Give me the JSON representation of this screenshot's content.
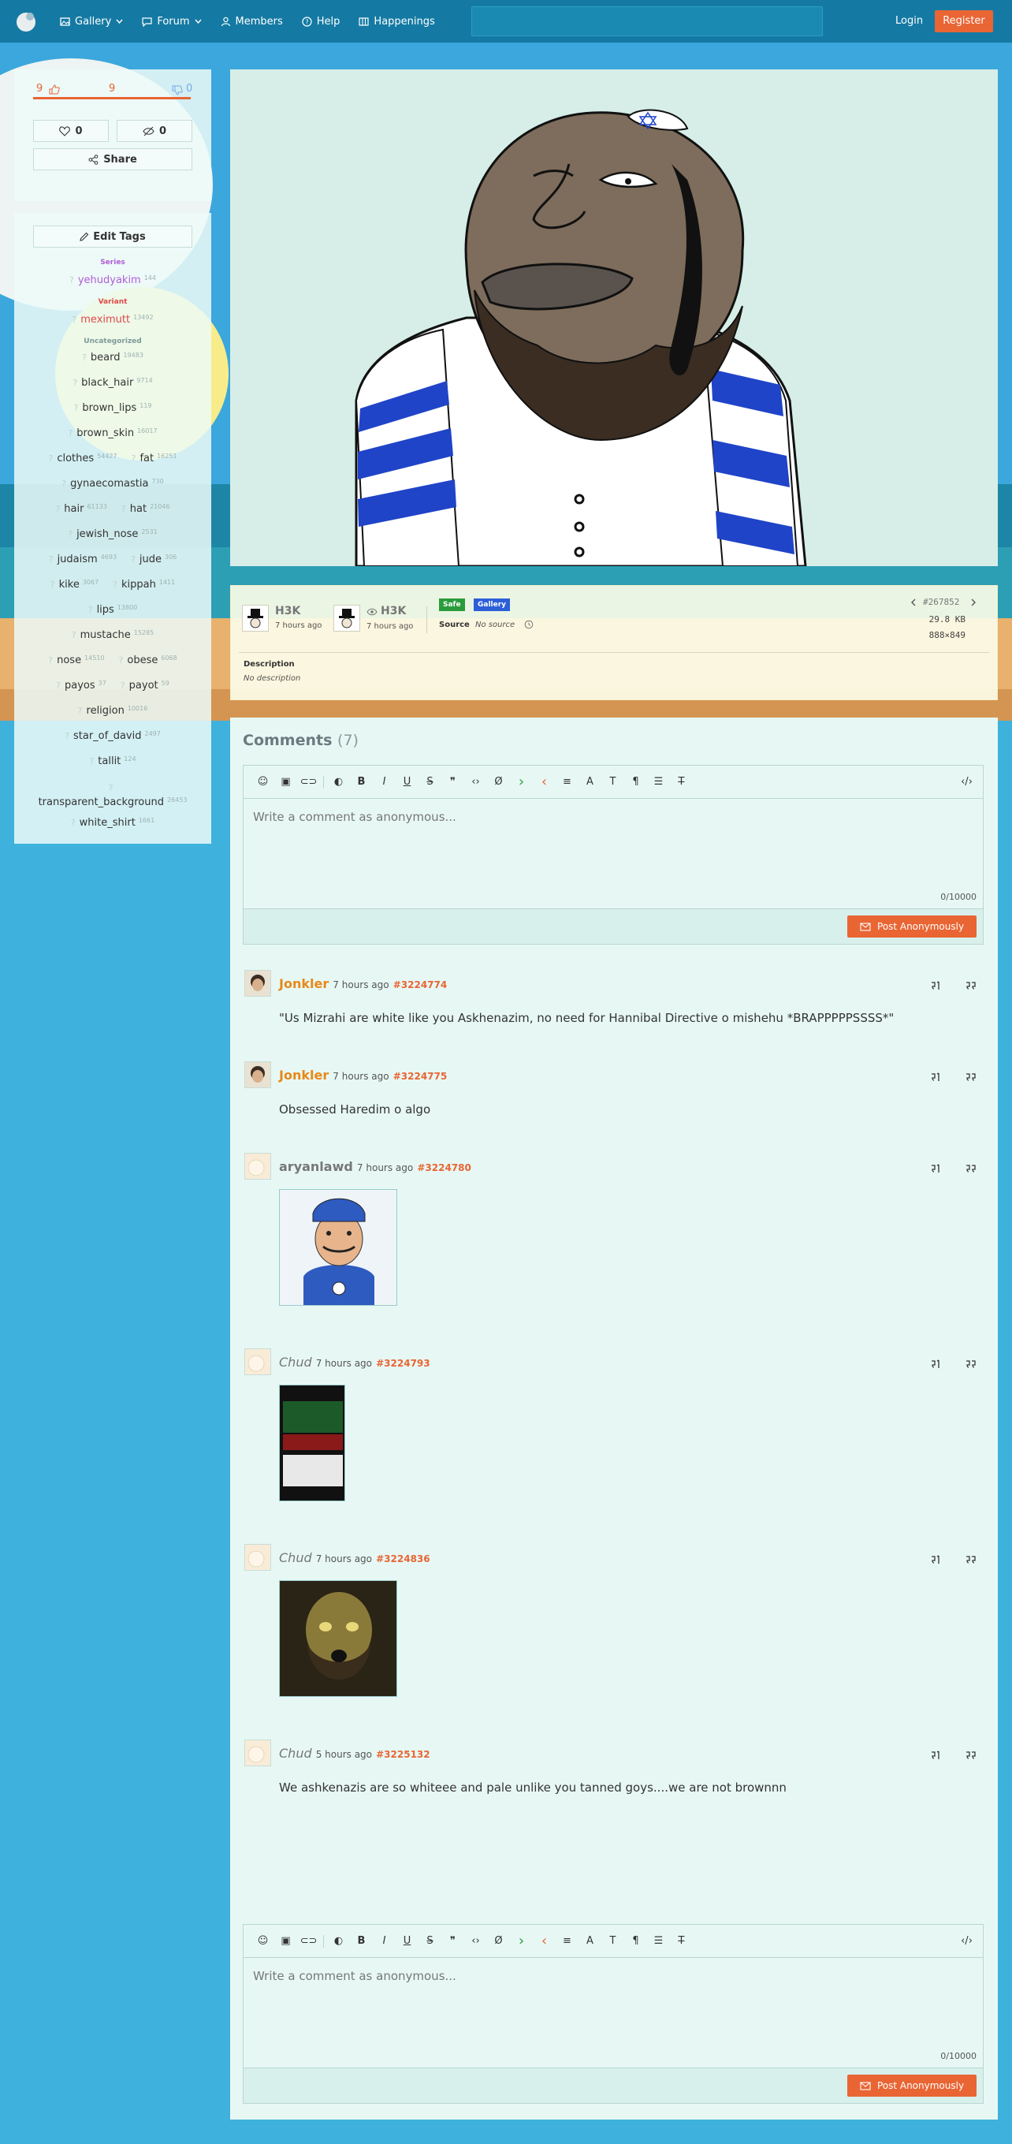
{
  "nav": {
    "gallery": "Gallery",
    "forum": "Forum",
    "members": "Members",
    "help": "Help",
    "happenings": "Happenings",
    "search_placeholder": "",
    "login": "Login",
    "register": "Register"
  },
  "votes": {
    "up": "9",
    "score": "9",
    "down": "0",
    "faves": "0",
    "hides": "0",
    "share": "Share"
  },
  "tags": {
    "edit_label": "Edit Tags",
    "categories": {
      "series": "Series",
      "variant": "Variant",
      "uncategorized": "Uncategorized"
    },
    "series": [
      {
        "name": "yehudyakim",
        "count": "144"
      }
    ],
    "variant": [
      {
        "name": "meximutt",
        "count": "13492"
      }
    ],
    "rows": [
      [
        {
          "name": "beard",
          "count": "19483"
        }
      ],
      [
        {
          "name": "black_hair",
          "count": "9714"
        }
      ],
      [
        {
          "name": "brown_lips",
          "count": "119"
        }
      ],
      [
        {
          "name": "brown_skin",
          "count": "16017"
        }
      ],
      [
        {
          "name": "clothes",
          "count": "54427"
        },
        {
          "name": "fat",
          "count": "16251"
        }
      ],
      [
        {
          "name": "gynaecomastia",
          "count": "730"
        }
      ],
      [
        {
          "name": "hair",
          "count": "61133"
        },
        {
          "name": "hat",
          "count": "21046"
        }
      ],
      [
        {
          "name": "jewish_nose",
          "count": "2531"
        }
      ],
      [
        {
          "name": "judaism",
          "count": "4693"
        },
        {
          "name": "jude",
          "count": "306"
        }
      ],
      [
        {
          "name": "kike",
          "count": "3067"
        },
        {
          "name": "kippah",
          "count": "1411"
        }
      ],
      [
        {
          "name": "lips",
          "count": "13800"
        }
      ],
      [
        {
          "name": "mustache",
          "count": "15285"
        }
      ],
      [
        {
          "name": "nose",
          "count": "14510"
        },
        {
          "name": "obese",
          "count": "6068"
        }
      ],
      [
        {
          "name": "payos",
          "count": "37"
        },
        {
          "name": "payot",
          "count": "59"
        }
      ],
      [
        {
          "name": "religion",
          "count": "10016"
        }
      ],
      [
        {
          "name": "star_of_david",
          "count": "2497"
        }
      ],
      [
        {
          "name": "tallit",
          "count": "124"
        }
      ],
      [
        {
          "name": "transparent_background",
          "count": "26453"
        }
      ],
      [
        {
          "name": "white_shirt",
          "count": "1661"
        }
      ]
    ]
  },
  "post": {
    "uploader": "H3K",
    "upload_time": "7 hours ago",
    "viewer": "H3K",
    "viewer_time": "7 hours ago",
    "rating_badge": "Safe",
    "gallery_badge": "Gallery",
    "source_label": "Source",
    "source_value": "No source",
    "id": "#267852",
    "filesize": "29.8 KB",
    "dimensions": "888×849",
    "description_label": "Description",
    "description_value": "No description"
  },
  "comments": {
    "heading": "Comments",
    "count": "(7)",
    "placeholder": "Write a comment as anonymous...",
    "char_count": "0/10000",
    "post_button": "Post Anonymously",
    "items": [
      {
        "user": "Jonkler",
        "time": "7 hours ago",
        "num": "#3224774",
        "text": "\"Us Mizrahi are white like you Askhenazim, no need for Hannibal Directive o mishehu *BRAPPPPPSSSS*\""
      },
      {
        "user": "Jonkler",
        "time": "7 hours ago",
        "num": "#3224775",
        "text": "Obsessed Haredim o algo"
      },
      {
        "user": "aryanlawd",
        "time": "7 hours ago",
        "num": "#3224780",
        "text": ""
      },
      {
        "user": "Chud",
        "time": "7 hours ago",
        "num": "#3224793",
        "text": ""
      },
      {
        "user": "Chud",
        "time": "7 hours ago",
        "num": "#3224836",
        "text": ""
      },
      {
        "user": "Chud",
        "time": "5 hours ago",
        "num": "#3225132",
        "text": "We ashkenazis are so whiteee and pale unlike you tanned goys....we are not brownnn"
      }
    ]
  },
  "colors": {
    "accent": "#e96534",
    "header": "#157aa3",
    "background": "#3eb1dc",
    "safe": "#2a9b3a",
    "gallery": "#2c5fd8"
  }
}
